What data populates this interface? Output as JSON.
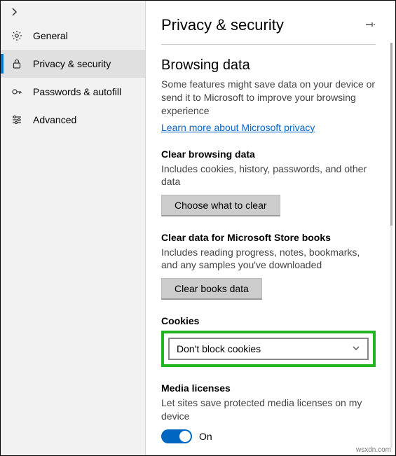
{
  "sidebar": {
    "items": [
      {
        "label": "General"
      },
      {
        "label": "Privacy & security"
      },
      {
        "label": "Passwords & autofill"
      },
      {
        "label": "Advanced"
      }
    ]
  },
  "header": {
    "title": "Privacy & security"
  },
  "browsing_data": {
    "title": "Browsing data",
    "desc": "Some features might save data on your device or send it to Microsoft to improve your browsing experience",
    "link": "Learn more about Microsoft privacy"
  },
  "clear_data": {
    "title": "Clear browsing data",
    "desc": "Includes cookies, history, passwords, and other data",
    "button": "Choose what to clear"
  },
  "clear_books": {
    "title": "Clear data for Microsoft Store books",
    "desc": "Includes reading progress, notes, bookmarks, and any samples you've downloaded",
    "button": "Clear books data"
  },
  "cookies": {
    "title": "Cookies",
    "selected": "Don't block cookies"
  },
  "media_licenses": {
    "title": "Media licenses",
    "desc": "Let sites save protected media licenses on my device",
    "toggle_label": "On"
  },
  "attribution": "wsxdn.com"
}
